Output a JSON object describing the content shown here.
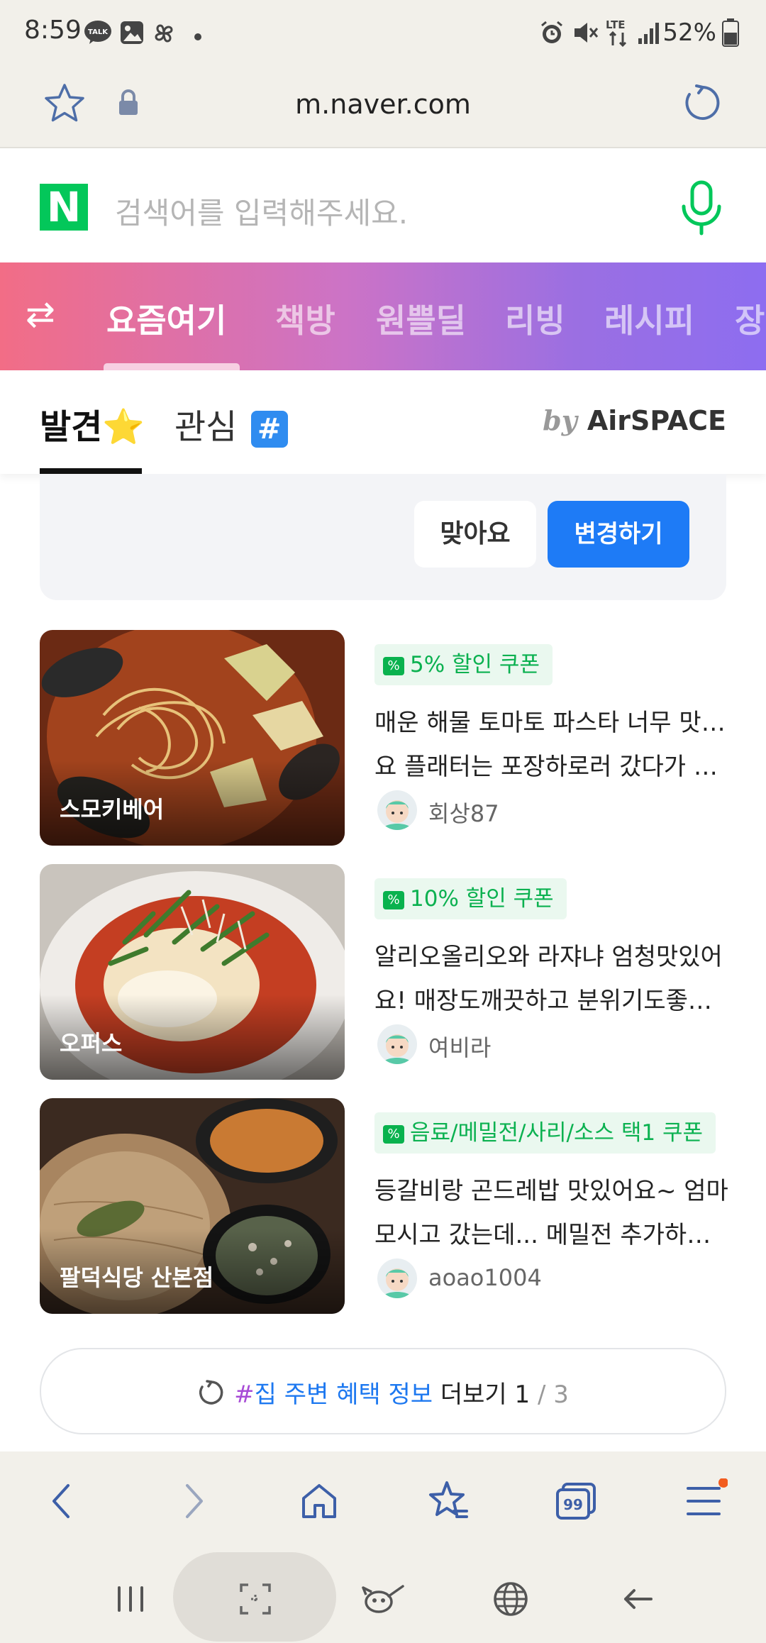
{
  "status_bar": {
    "time": "8:59",
    "battery": "52%",
    "icons": [
      "kakaotalk-icon",
      "gallery-icon",
      "pinwheel-icon",
      "dot-icon",
      "alarm-icon",
      "mute-icon",
      "lte-icon",
      "signal-icon",
      "battery-icon"
    ]
  },
  "browser": {
    "url": "m.naver.com"
  },
  "search": {
    "logo": "N",
    "placeholder": "검색어를 입력해주세요."
  },
  "top_nav": {
    "tabs": [
      "요즘여기",
      "책방",
      "원쁠딜",
      "리빙",
      "레시피",
      "장"
    ],
    "active_index": 0
  },
  "sub_tabs": {
    "discover": "발견⭐",
    "interest": "관심",
    "hash_badge": "#",
    "by": "by",
    "brand": "AirSPACE"
  },
  "feedback": {
    "ok_label": "맞아요",
    "change_label": "변경하기"
  },
  "items": [
    {
      "place": "스모키베어",
      "coupon": "5% 할인 쿠폰",
      "review_line1": "매운 해물 토마토 파스타 너무 맛있어",
      "review_line2": "요 플래터는 포장하로러 갔다가 간...",
      "author": "회상87"
    },
    {
      "place": "오퍼스",
      "coupon": "10% 할인 쿠폰",
      "review_line1": "알리오올리오와 라쟈냐 엄청맛있어",
      "review_line2": "요! 매장도깨끗하고 분위기도좋아...",
      "author": "여비라"
    },
    {
      "place": "팔덕식당 산본점",
      "coupon": "음료/메밀전/사리/소스 택1 쿠폰",
      "review_line1": "등갈비랑 곤드레밥 맛있어요~ 엄마",
      "review_line2": "모시고 갔는데... 메밀전 추가하셨...",
      "author": "aoao1004"
    }
  ],
  "more": {
    "hash": "#",
    "topic": "집 주변 혜택 정보",
    "label": "더보기",
    "current": "1",
    "total": "/ 3"
  },
  "toolbar": {
    "icons": [
      "back-icon",
      "forward-icon",
      "home-icon",
      "bookmarks-icon",
      "tabs-icon",
      "menu-icon"
    ],
    "tabs_count": "99"
  },
  "nav_bar": {
    "icons": [
      "recents-icon",
      "home-capture-icon",
      "assistant-icon",
      "internet-icon",
      "back-nav-icon"
    ]
  },
  "colors": {
    "naver_green": "#03c75a",
    "accent_blue": "#1e7bf6",
    "coupon_green": "#0bb150",
    "nav_gradient_start": "#f26d86",
    "nav_gradient_end": "#8d6df0"
  }
}
